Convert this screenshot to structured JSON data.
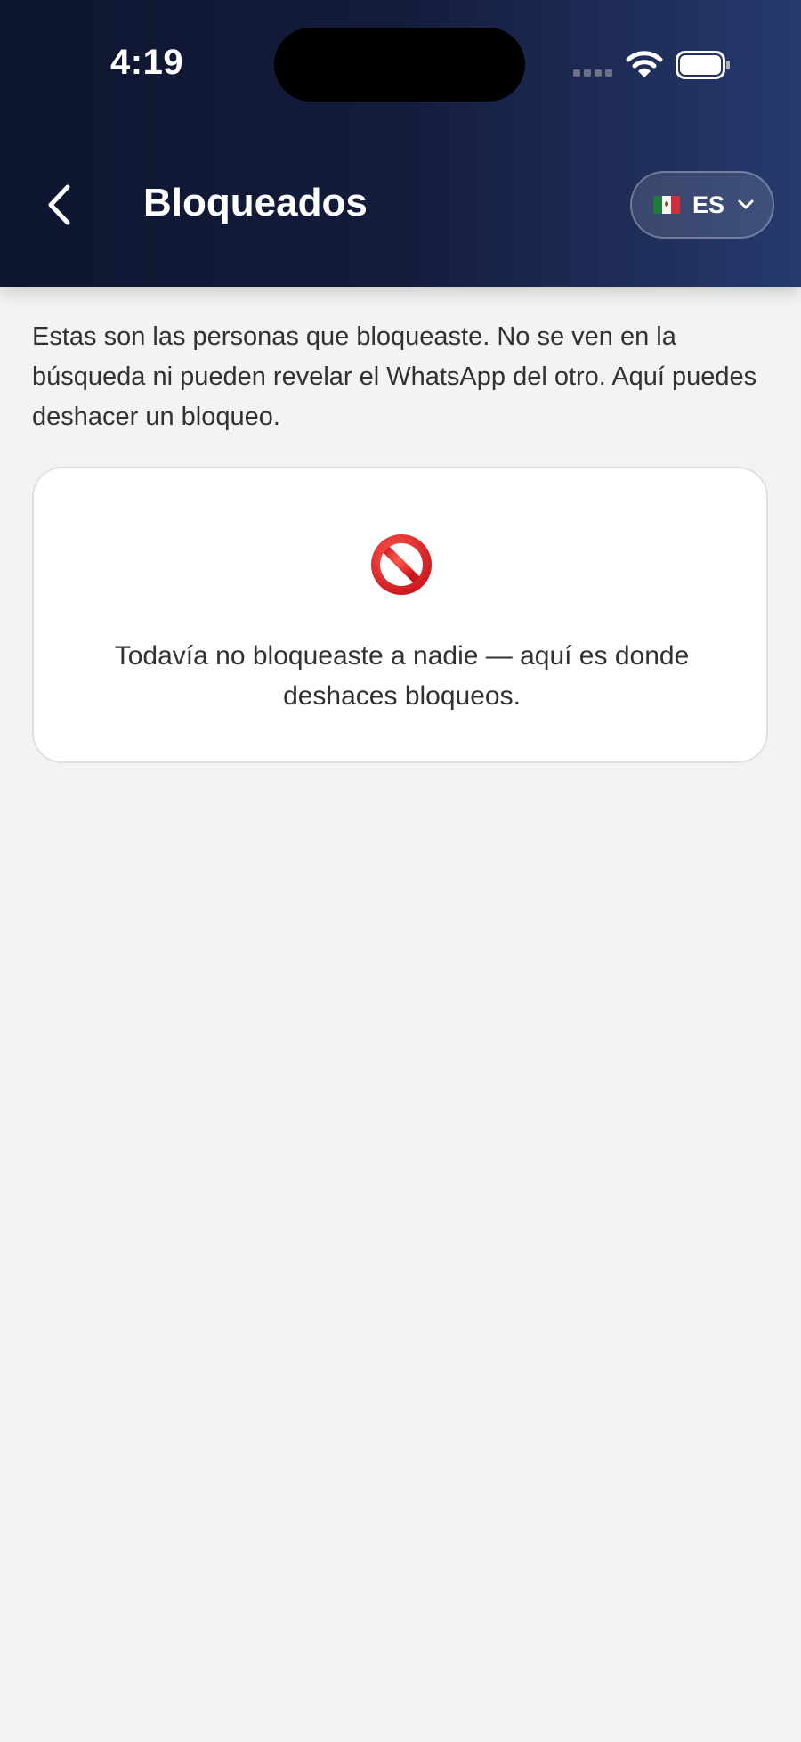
{
  "status_bar": {
    "time": "4:19"
  },
  "header": {
    "title": "Bloqueados",
    "back_icon": "chevron-left-icon",
    "language": {
      "label": "ES",
      "flag_icon": "mexico-flag-icon",
      "dropdown_icon": "chevron-down-icon"
    }
  },
  "main": {
    "description": "Estas son las personas que bloqueaste. No se ven en la búsqueda ni pueden revelar el WhatsApp del otro. Aquí puedes deshacer un bloqueo.",
    "empty_state": {
      "icon": "no-entry-icon",
      "message": "Todavía no bloqueaste a nadie — aquí es donde deshaces bloqueos."
    }
  },
  "colors": {
    "header_gradient_start": "#0e1530",
    "header_gradient_end": "#263a6e",
    "background": "#f3f4f2",
    "card_background": "#ffffff",
    "text": "#2f3133",
    "blocked_red": "#e0262b"
  }
}
